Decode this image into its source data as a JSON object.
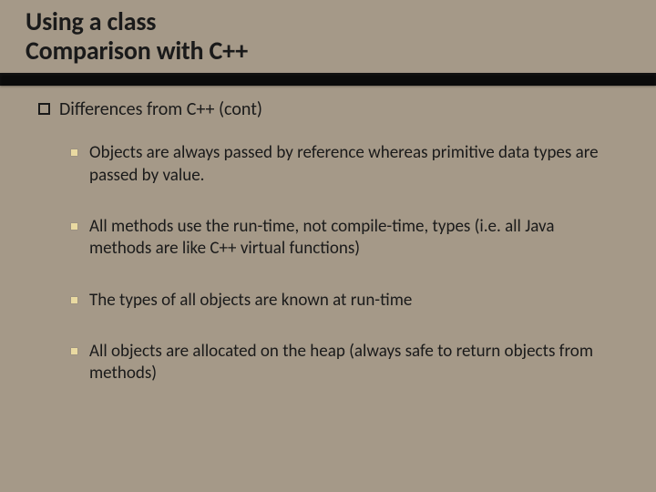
{
  "title": {
    "line1": "Using a class",
    "line2": "Comparison with C++"
  },
  "subheading": "Differences from C++ (cont)",
  "bullets": [
    "Objects are always passed by reference whereas primitive data types are passed by value.",
    "All methods use the run-time, not compile-time, types (i.e. all Java methods are like C++ virtual functions)",
    "The types of all objects are known at run-time",
    "All objects are allocated on the heap (always safe to return objects from methods)"
  ]
}
